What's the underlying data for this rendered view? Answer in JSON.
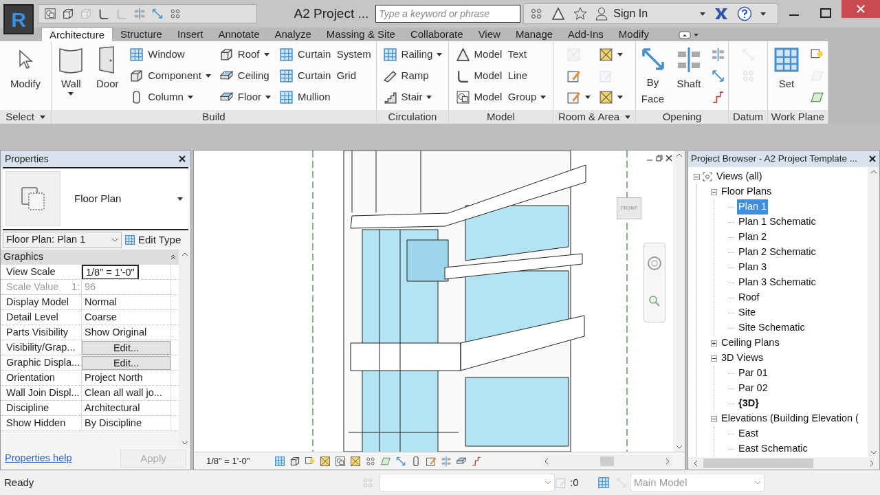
{
  "app": {
    "logo": "R",
    "title": "A2 Project ...",
    "search_placeholder": "Type a keyword or phrase",
    "sign_in": "Sign In"
  },
  "tabs": [
    {
      "label": "Architecture",
      "selected": true
    },
    {
      "label": "Structure",
      "selected": false
    },
    {
      "label": "Insert",
      "selected": false
    },
    {
      "label": "Annotate",
      "selected": false
    },
    {
      "label": "Analyze",
      "selected": false
    },
    {
      "label": "Massing & Site",
      "selected": false
    },
    {
      "label": "Collaborate",
      "selected": false
    },
    {
      "label": "View",
      "selected": false
    },
    {
      "label": "Manage",
      "selected": false
    },
    {
      "label": "Add-Ins",
      "selected": false
    },
    {
      "label": "Modify",
      "selected": false
    }
  ],
  "ribbon_panels": [
    {
      "title": "Select",
      "dropdown": true,
      "tools": [
        {
          "kind": "large",
          "label": "Modify",
          "dropdown": false,
          "disabled": false
        }
      ]
    },
    {
      "title": "Build",
      "dropdown": false,
      "tools": [
        {
          "kind": "large",
          "label": "Wall",
          "dropdown": true,
          "disabled": false
        },
        {
          "kind": "large",
          "label": "Door",
          "dropdown": false,
          "disabled": false
        },
        {
          "kind": "small",
          "label": "Window",
          "dropdown": false,
          "disabled": false
        },
        {
          "kind": "small",
          "label": "Component",
          "dropdown": true,
          "disabled": false
        },
        {
          "kind": "small",
          "label": "Column",
          "dropdown": true,
          "disabled": false
        },
        {
          "kind": "small",
          "label": "Roof",
          "dropdown": true,
          "disabled": false
        },
        {
          "kind": "small",
          "label": "Ceiling",
          "dropdown": false,
          "disabled": false
        },
        {
          "kind": "small",
          "label": "Floor",
          "dropdown": true,
          "disabled": false
        },
        {
          "kind": "small",
          "label": "Curtain  System",
          "dropdown": false,
          "disabled": false
        },
        {
          "kind": "small",
          "label": "Curtain  Grid",
          "dropdown": false,
          "disabled": false
        },
        {
          "kind": "small",
          "label": "Mullion",
          "dropdown": false,
          "disabled": false
        }
      ]
    },
    {
      "title": "Circulation",
      "dropdown": false,
      "tools": [
        {
          "kind": "small",
          "label": "Railing",
          "dropdown": true,
          "disabled": false
        },
        {
          "kind": "small",
          "label": "Ramp",
          "dropdown": false,
          "disabled": false
        },
        {
          "kind": "small",
          "label": "Stair",
          "dropdown": true,
          "disabled": false
        }
      ]
    },
    {
      "title": "Model",
      "dropdown": false,
      "tools": [
        {
          "kind": "small",
          "label": "Model  Text",
          "dropdown": false,
          "disabled": false
        },
        {
          "kind": "small",
          "label": "Model  Line",
          "dropdown": false,
          "disabled": false
        },
        {
          "kind": "small",
          "label": "Model  Group",
          "dropdown": true,
          "disabled": false
        }
      ]
    },
    {
      "title": "Room & Area",
      "dropdown": true,
      "tools": [
        {
          "kind": "icon",
          "dropdown": false,
          "disabled": true
        },
        {
          "kind": "icon",
          "dropdown": false,
          "disabled": false
        },
        {
          "kind": "icon",
          "dropdown": true,
          "disabled": false
        },
        {
          "kind": "icon",
          "dropdown": true,
          "disabled": false
        },
        {
          "kind": "icon",
          "dropdown": false,
          "disabled": true
        },
        {
          "kind": "icon",
          "dropdown": true,
          "disabled": false
        }
      ]
    },
    {
      "title": "Opening",
      "dropdown": false,
      "tools": [
        {
          "kind": "large",
          "label": "By Face",
          "dropdown": false,
          "disabled": false
        },
        {
          "kind": "large",
          "label": "Shaft",
          "dropdown": false,
          "disabled": false
        },
        {
          "kind": "icon",
          "dropdown": false,
          "disabled": false
        },
        {
          "kind": "icon",
          "dropdown": false,
          "disabled": false
        },
        {
          "kind": "icon",
          "dropdown": false,
          "disabled": false
        }
      ]
    },
    {
      "title": "Datum",
      "dropdown": false,
      "tools": [
        {
          "kind": "icon",
          "dropdown": false,
          "disabled": true
        },
        {
          "kind": "icon",
          "dropdown": false,
          "disabled": true
        }
      ]
    },
    {
      "title": "Work Plane",
      "dropdown": false,
      "tools": [
        {
          "kind": "large",
          "label": "Set",
          "dropdown": false,
          "disabled": false
        },
        {
          "kind": "icon",
          "dropdown": false,
          "disabled": false
        },
        {
          "kind": "icon",
          "dropdown": false,
          "disabled": true
        },
        {
          "kind": "icon",
          "dropdown": false,
          "disabled": false
        }
      ]
    }
  ],
  "properties": {
    "title": "Properties",
    "type_name": "Floor Plan",
    "instance": "Floor Plan: Plan 1",
    "edit_type": "Edit Type",
    "group": "Graphics",
    "rows": [
      {
        "name": "View Scale",
        "value": "1/8\" = 1'-0\"",
        "kind": "field"
      },
      {
        "name": "Scale Value",
        "suffix": "1:",
        "value": "96",
        "kind": "readonly"
      },
      {
        "name": "Display Model",
        "value": "Normal",
        "kind": "text"
      },
      {
        "name": "Detail Level",
        "value": "Coarse",
        "kind": "text"
      },
      {
        "name": "Parts Visibility",
        "value": "Show Original",
        "kind": "text"
      },
      {
        "name": "Visibility/Grap...",
        "value": "Edit...",
        "kind": "button"
      },
      {
        "name": "Graphic Displa...",
        "value": "Edit...",
        "kind": "button"
      },
      {
        "name": "Orientation",
        "value": "Project North",
        "kind": "text"
      },
      {
        "name": "Wall Join Displ...",
        "value": "Clean all wall jo...",
        "kind": "text"
      },
      {
        "name": "Discipline",
        "value": "Architectural",
        "kind": "text"
      },
      {
        "name": "Show Hidden",
        "value": "By Discipline",
        "kind": "text"
      }
    ],
    "help": "Properties help",
    "apply": "Apply"
  },
  "viewport": {
    "view_cube": "FRONT",
    "scale": "1/8\" = 1'-0\""
  },
  "browser": {
    "title": "Project Browser - A2 Project Template ...",
    "tree": [
      {
        "label": "Views (all)",
        "expanded": true,
        "selected": false,
        "bold": false,
        "children": [
          {
            "label": "Floor Plans",
            "expanded": true,
            "selected": false,
            "bold": false,
            "children": [
              {
                "label": "Plan 1",
                "selected": true,
                "bold": false
              },
              {
                "label": "Plan 1 Schematic",
                "selected": false,
                "bold": false
              },
              {
                "label": "Plan 2",
                "selected": false,
                "bold": false
              },
              {
                "label": "Plan 2 Schematic",
                "selected": false,
                "bold": false
              },
              {
                "label": "Plan 3",
                "selected": false,
                "bold": false
              },
              {
                "label": "Plan 3 Schematic",
                "selected": false,
                "bold": false
              },
              {
                "label": "Roof",
                "selected": false,
                "bold": false
              },
              {
                "label": "Site",
                "selected": false,
                "bold": false
              },
              {
                "label": "Site Schematic",
                "selected": false,
                "bold": false
              }
            ]
          },
          {
            "label": "Ceiling Plans",
            "expanded": false,
            "selected": false,
            "bold": false
          },
          {
            "label": "3D Views",
            "expanded": true,
            "selected": false,
            "bold": false,
            "children": [
              {
                "label": "Par 01",
                "selected": false,
                "bold": false
              },
              {
                "label": "Par 02",
                "selected": false,
                "bold": false
              },
              {
                "label": "{3D}",
                "selected": false,
                "bold": true
              }
            ]
          },
          {
            "label": "Elevations (Building Elevation (",
            "expanded": true,
            "selected": false,
            "bold": false,
            "children": [
              {
                "label": "East",
                "selected": false,
                "bold": false
              },
              {
                "label": "East Schematic",
                "selected": false,
                "bold": false
              }
            ]
          }
        ]
      }
    ]
  },
  "status": {
    "text": "Ready",
    "count": ":0",
    "model": "Main Model"
  }
}
